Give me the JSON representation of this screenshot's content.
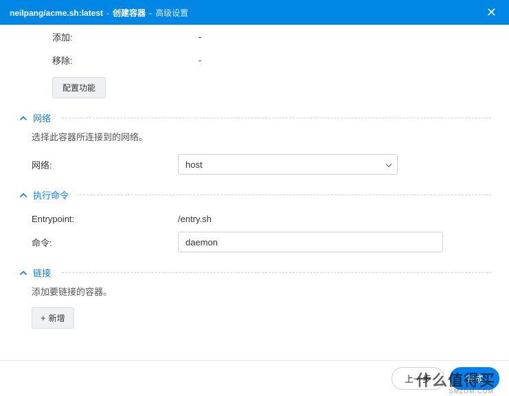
{
  "header": {
    "image": "neilpang/acme.sh:latest",
    "sep1": "-",
    "step": "创建容器",
    "sep2": "-",
    "substep": "高级设置"
  },
  "top_section": {
    "add_label": "添加:",
    "add_value": "-",
    "remove_label": "移除:",
    "remove_value": "-",
    "config_button": "配置功能"
  },
  "network": {
    "title": "网络",
    "desc": "选择此容器所连接到的网络。",
    "label": "网络:",
    "value": "host"
  },
  "exec": {
    "title": "执行命令",
    "entrypoint_label": "Entrypoint:",
    "entrypoint_value": "/entry.sh",
    "command_label": "命令:",
    "command_value": "daemon"
  },
  "link": {
    "title": "链接",
    "desc": "添加要链接的容器。",
    "add_button": "新增"
  },
  "footer": {
    "back": "上一步",
    "done": "完成"
  },
  "watermark": {
    "main": "什么值得买",
    "sub": "SMZDM.COM"
  }
}
